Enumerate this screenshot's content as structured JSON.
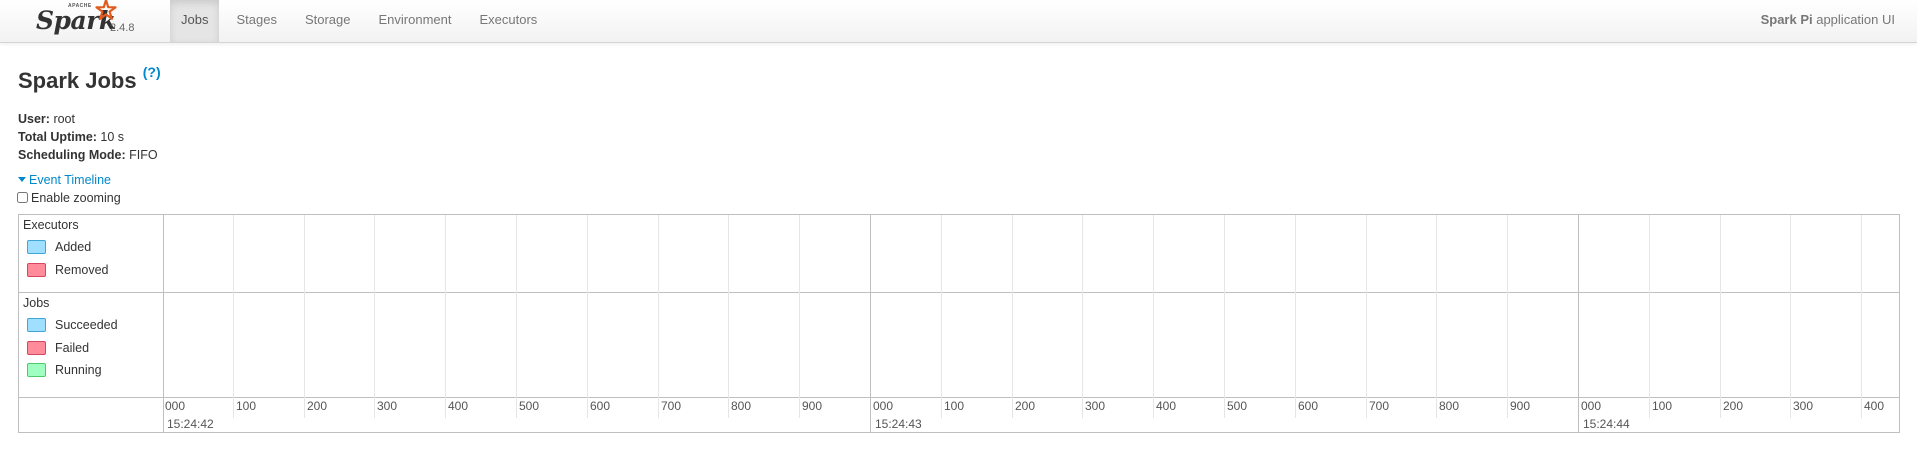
{
  "nav": {
    "brand_small": "APACHE",
    "brand_name": "Spark",
    "version": "2.4.8",
    "tabs": [
      {
        "label": "Jobs",
        "active": true
      },
      {
        "label": "Stages",
        "active": false
      },
      {
        "label": "Storage",
        "active": false
      },
      {
        "label": "Environment",
        "active": false
      },
      {
        "label": "Executors",
        "active": false
      }
    ],
    "app_name": "Spark Pi",
    "app_suffix": " application UI"
  },
  "page": {
    "title": "Spark Jobs",
    "help": "(?)"
  },
  "summary": {
    "user_label": "User:",
    "user_value": " root",
    "uptime_label": "Total Uptime:",
    "uptime_value": " 10 s",
    "mode_label": "Scheduling Mode:",
    "mode_value": " FIFO"
  },
  "timeline": {
    "toggle_label": "Event Timeline",
    "zoom_label": "Enable zooming",
    "zoom_checked": false,
    "executors_title": "Executors",
    "executors_legend": [
      {
        "label": "Added",
        "color": "#a0dfff",
        "border": "#3ea6d8"
      },
      {
        "label": "Removed",
        "color": "#ff8b9b",
        "border": "#d8455e"
      }
    ],
    "jobs_title": "Jobs",
    "jobs_legend": [
      {
        "label": "Succeeded",
        "color": "#a0dfff",
        "border": "#3ea6d8"
      },
      {
        "label": "Failed",
        "color": "#ff8b9b",
        "border": "#d8455e"
      },
      {
        "label": "Running",
        "color": "#a0ffc0",
        "border": "#4ec96c"
      }
    ],
    "ms_ticks": [
      "000",
      "100",
      "200",
      "300",
      "400",
      "500",
      "600",
      "700",
      "800",
      "900",
      "000",
      "100",
      "200",
      "300",
      "400",
      "500",
      "600",
      "700",
      "800",
      "900",
      "000",
      "100",
      "200",
      "300",
      "400"
    ],
    "time_labels": [
      "15:24:42",
      "15:24:43",
      "15:24:44"
    ]
  },
  "colors": {
    "accent": "#0088cc",
    "spark_orange": "#e25a1c"
  }
}
